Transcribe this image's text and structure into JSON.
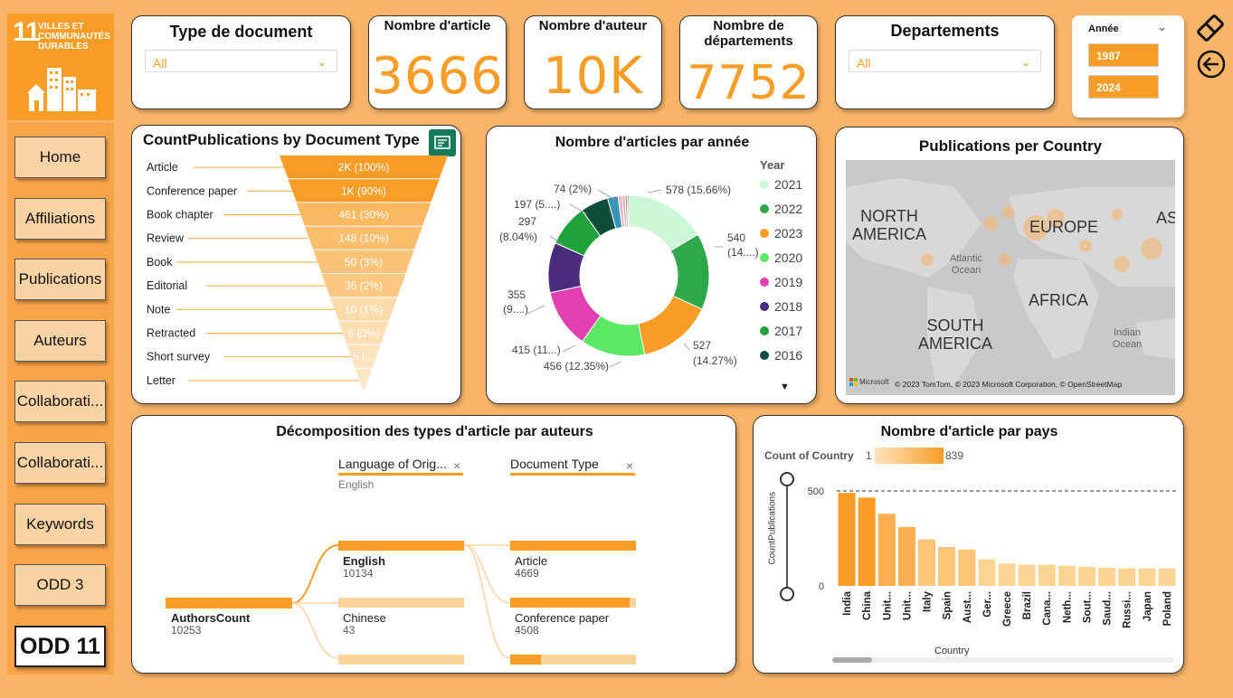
{
  "sdg": {
    "number": "11",
    "line1": "VILLES ET",
    "line2": "COMMUNAUTÉS",
    "line3": "DURABLES"
  },
  "nav": {
    "items": [
      "Home",
      "Affiliations",
      "Publications",
      "Auteurs",
      "Collaborati...",
      "Collaborati...",
      "Keywords",
      "ODD 3",
      "ODD 11"
    ],
    "active": "ODD 11"
  },
  "slicers": {
    "type_document": {
      "title": "Type de document",
      "value": "All"
    },
    "departements": {
      "title": "Departements",
      "value": "All"
    },
    "annee": {
      "title": "Année",
      "from": "1987",
      "to": "2024"
    }
  },
  "kpis": {
    "articles": {
      "title": "Nombre d'article",
      "value": "3666"
    },
    "auteurs": {
      "title": "Nombre d'auteur",
      "value": "10K"
    },
    "departements": {
      "title1": "Nombre de",
      "title2": "départements",
      "value": "7752"
    }
  },
  "funnel": {
    "title": "CountPublications by Document Type",
    "rows": [
      {
        "label": "Article",
        "value": "2K (100%)",
        "fraction": 1.0
      },
      {
        "label": "Conference paper",
        "value": "1K (90%)",
        "fraction": 0.9
      },
      {
        "label": "Book chapter",
        "value": "461 (30%)",
        "fraction": 0.8
      },
      {
        "label": "Review",
        "value": "148 (10%)",
        "fraction": 0.7
      },
      {
        "label": "Book",
        "value": "50 (3%)",
        "fraction": 0.6
      },
      {
        "label": "Editorial",
        "value": "35 (2%)",
        "fraction": 0.5
      },
      {
        "label": "Note",
        "value": "10 (1%)",
        "fraction": 0.4
      },
      {
        "label": "Retracted",
        "value": "6 (0%)",
        "fraction": 0.3
      },
      {
        "label": "Short survey",
        "value": "5 (...",
        "fraction": 0.2
      },
      {
        "label": "Letter",
        "value": "",
        "fraction": 0.1
      }
    ]
  },
  "donut": {
    "title": "Nombre d'articles par année",
    "legend_title": "Year",
    "legend": [
      {
        "year": "2021",
        "color": "#ccf7d8"
      },
      {
        "year": "2022",
        "color": "#2ea84a"
      },
      {
        "year": "2023",
        "color": "#f99d26"
      },
      {
        "year": "2020",
        "color": "#5ae865"
      },
      {
        "year": "2019",
        "color": "#e23fb0"
      },
      {
        "year": "2018",
        "color": "#4a2c7e"
      },
      {
        "year": "2017",
        "color": "#1fa23a"
      },
      {
        "year": "2016",
        "color": "#0e4d3d"
      }
    ],
    "labels": [
      "578 (15.66%)",
      "540",
      "(14....)",
      "527",
      "(14.27%)",
      "456 (12.35%)",
      "415 (11...)",
      "355",
      "(9....)",
      "297",
      "(8.04%)",
      "197 (5....)",
      "74 (2%)"
    ]
  },
  "map": {
    "title": "Publications per Country",
    "labels": [
      "NORTH",
      "AMERICA",
      "EUROPE",
      "ASIA",
      "AFRICA",
      "SOUTH",
      "AMERICA"
    ],
    "oceans": [
      "Atlantic",
      "Ocean",
      "Indian",
      "Ocean"
    ],
    "attribution": "© 2023 TomTom, © 2023 Microsoft Corporation, © OpenStreetMap",
    "brand": "Microsoft"
  },
  "decomp": {
    "title": "Décomposition des types d'article par auteurs",
    "col1_header": "Language of Orig...",
    "col1_sub": "English",
    "col2_header": "Document Type",
    "root": {
      "label": "AuthorsCount",
      "value": "10253"
    },
    "col1_nodes": [
      {
        "label": "English",
        "value": "10134"
      },
      {
        "label": "Chinese",
        "value": "43"
      }
    ],
    "col2_nodes": [
      {
        "label": "Article",
        "value": "4669"
      },
      {
        "label": "Conference paper",
        "value": "4508"
      }
    ]
  },
  "barchart": {
    "title": "Nombre d'article par pays",
    "legend_label": "Count of Country",
    "legend_min": "1",
    "legend_max": "839",
    "y_label": "CountPublications",
    "x_label": "Country",
    "y_ticks": [
      "500",
      "0"
    ]
  },
  "chart_data": {
    "type": "bar",
    "categories": [
      "India",
      "China",
      "Unit...",
      "Unit...",
      "Italy",
      "Spain",
      "Aust...",
      "Ger...",
      "Greece",
      "Brazil",
      "Cana...",
      "Neth...",
      "Sout...",
      "Saud...",
      "Russi...",
      "Japan",
      "Poland"
    ],
    "values": [
      490,
      465,
      380,
      310,
      245,
      205,
      192,
      140,
      118,
      112,
      112,
      106,
      100,
      96,
      93,
      92,
      92
    ],
    "title": "Nombre d'article par pays",
    "xlabel": "Country",
    "ylabel": "CountPublications",
    "ylim": [
      0,
      600
    ],
    "reference_line": 500
  }
}
